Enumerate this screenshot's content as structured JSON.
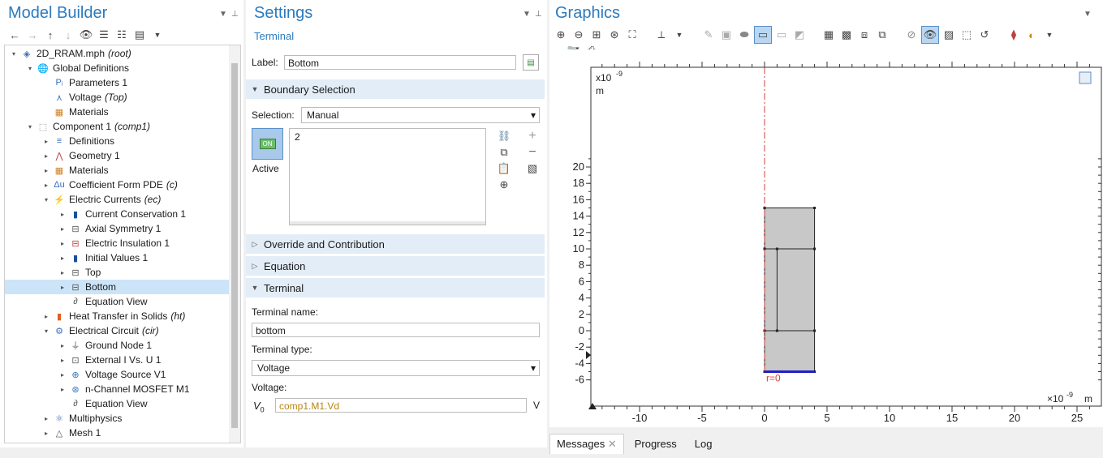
{
  "model_builder": {
    "title": "Model Builder",
    "tree": [
      {
        "label": "2D_RRAM.mph",
        "suffix": "(root)",
        "icon": "model-icon",
        "depth": 0,
        "expander": "▾"
      },
      {
        "label": "Global Definitions",
        "suffix": "",
        "icon": "globe-icon",
        "depth": 1,
        "expander": "▾"
      },
      {
        "label": "Parameters 1",
        "suffix": "",
        "icon": "parameters-icon",
        "depth": 2,
        "expander": ""
      },
      {
        "label": "Voltage",
        "suffix": "(Top)",
        "icon": "probe-icon",
        "depth": 2,
        "expander": ""
      },
      {
        "label": "Materials",
        "suffix": "",
        "icon": "materials-icon",
        "depth": 2,
        "expander": ""
      },
      {
        "label": "Component 1",
        "suffix": "(comp1)",
        "icon": "component-icon",
        "depth": 1,
        "expander": "▾"
      },
      {
        "label": "Definitions",
        "suffix": "",
        "icon": "definitions-icon",
        "depth": 2,
        "expander": "▸"
      },
      {
        "label": "Geometry 1",
        "suffix": "",
        "icon": "geometry-icon",
        "depth": 2,
        "expander": "▸"
      },
      {
        "label": "Materials",
        "suffix": "",
        "icon": "materials-icon",
        "depth": 2,
        "expander": "▸"
      },
      {
        "label": "Coefficient Form PDE",
        "suffix": "(c)",
        "icon": "pde-icon",
        "depth": 2,
        "expander": "▸"
      },
      {
        "label": "Electric Currents",
        "suffix": "(ec)",
        "icon": "electric-currents-icon",
        "depth": 2,
        "expander": "▾"
      },
      {
        "label": "Current Conservation 1",
        "suffix": "",
        "icon": "domain-node-icon",
        "depth": 3,
        "expander": "▸"
      },
      {
        "label": "Axial Symmetry 1",
        "suffix": "",
        "icon": "boundary-node-icon",
        "depth": 3,
        "expander": "▸"
      },
      {
        "label": "Electric Insulation 1",
        "suffix": "",
        "icon": "insulation-icon",
        "depth": 3,
        "expander": "▸"
      },
      {
        "label": "Initial Values 1",
        "suffix": "",
        "icon": "domain-node-icon",
        "depth": 3,
        "expander": "▸"
      },
      {
        "label": "Top",
        "suffix": "",
        "icon": "boundary-node-icon",
        "depth": 3,
        "expander": "▸"
      },
      {
        "label": "Bottom",
        "suffix": "",
        "icon": "boundary-node-icon",
        "depth": 3,
        "expander": "▸",
        "selected": true
      },
      {
        "label": "Equation View",
        "suffix": "",
        "icon": "equation-view-icon",
        "depth": 3,
        "expander": ""
      },
      {
        "label": "Heat Transfer in Solids",
        "suffix": "(ht)",
        "icon": "heat-transfer-icon",
        "depth": 2,
        "expander": "▸"
      },
      {
        "label": "Electrical Circuit",
        "suffix": "(cir)",
        "icon": "circuit-icon",
        "depth": 2,
        "expander": "▾"
      },
      {
        "label": "Ground Node 1",
        "suffix": "",
        "icon": "ground-icon",
        "depth": 3,
        "expander": "▸"
      },
      {
        "label": "External I Vs. U 1",
        "suffix": "",
        "icon": "external-iu-icon",
        "depth": 3,
        "expander": "▸"
      },
      {
        "label": "Voltage Source V1",
        "suffix": "",
        "icon": "voltage-source-icon",
        "depth": 3,
        "expander": "▸"
      },
      {
        "label": "n-Channel MOSFET M1",
        "suffix": "",
        "icon": "mosfet-icon",
        "depth": 3,
        "expander": "▸"
      },
      {
        "label": "Equation View",
        "suffix": "",
        "icon": "equation-view-icon",
        "depth": 3,
        "expander": ""
      },
      {
        "label": "Multiphysics",
        "suffix": "",
        "icon": "multiphysics-icon",
        "depth": 2,
        "expander": "▸"
      },
      {
        "label": "Mesh 1",
        "suffix": "",
        "icon": "mesh-icon",
        "depth": 2,
        "expander": "▸"
      }
    ]
  },
  "settings": {
    "title": "Settings",
    "subtitle": "Terminal",
    "label_caption": "Label:",
    "label_value": "Bottom",
    "boundary_selection": {
      "header": "Boundary Selection",
      "selection_caption": "Selection:",
      "selection_value": "Manual",
      "active_toggle": "ON",
      "active_label": "Active",
      "list_items": [
        "2"
      ]
    },
    "sections": {
      "override": "Override and Contribution",
      "equation": "Equation",
      "terminal": "Terminal"
    },
    "terminal": {
      "name_caption": "Terminal name:",
      "name_value": "bottom",
      "type_caption": "Terminal type:",
      "type_value": "Voltage",
      "voltage_caption": "Voltage:",
      "voltage_symbol": "V",
      "voltage_sub": "0",
      "voltage_value": "comp1.M1.Vd",
      "voltage_unit": "V"
    }
  },
  "graphics": {
    "title": "Graphics",
    "x_multiplier": "×10",
    "x_exp": "-9",
    "x_unit": "m",
    "y_multiplier": "x10",
    "y_exp": "-9",
    "y_unit": "m",
    "axis_label": "r=0",
    "x_ticks": [
      "-10",
      "-5",
      "0",
      "5",
      "10",
      "15",
      "20",
      "25"
    ],
    "y_ticks": [
      "20",
      "18",
      "16",
      "14",
      "12",
      "10",
      "8",
      "6",
      "4",
      "2",
      "0",
      "-2",
      "-4",
      "-6"
    ],
    "colors": {
      "geometry_fill": "#c8c8c8",
      "selected_boundary": "#1f1fc8",
      "symmetry_axis": "#d04040"
    }
  },
  "bottom_tabs": [
    "Messages",
    "Progress",
    "Log"
  ]
}
